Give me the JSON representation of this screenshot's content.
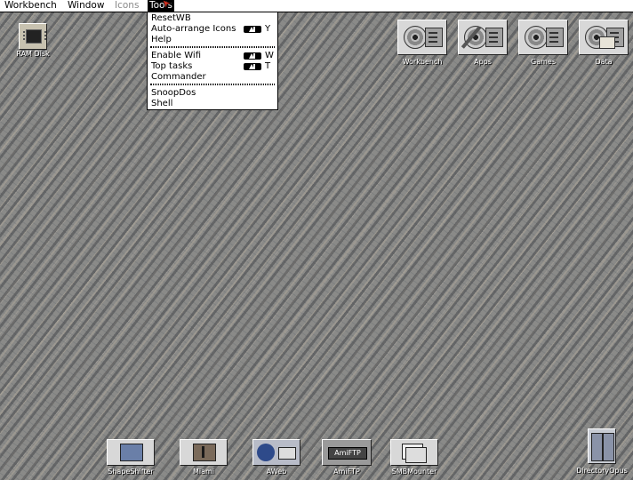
{
  "menubar": {
    "items": [
      {
        "label": "Workbench",
        "state": "normal"
      },
      {
        "label": "Window",
        "state": "normal"
      },
      {
        "label": "Icons",
        "state": "disabled"
      },
      {
        "label": "Tools",
        "state": "active"
      }
    ]
  },
  "tools_menu": {
    "groups": [
      [
        {
          "label": "ResetWB",
          "shortcut": ""
        },
        {
          "label": "Auto-arrange Icons",
          "shortcut": "Y"
        },
        {
          "label": "Help",
          "shortcut": ""
        }
      ],
      [
        {
          "label": "Enable Wifi",
          "shortcut": "W"
        },
        {
          "label": "Top tasks",
          "shortcut": "T"
        },
        {
          "label": "Commander",
          "shortcut": ""
        }
      ],
      [
        {
          "label": "SnoopDos",
          "shortcut": ""
        },
        {
          "label": "Shell",
          "shortcut": ""
        }
      ]
    ]
  },
  "desktop": {
    "top_left_icons": [
      {
        "label": "RAM Disk",
        "icon": "ram-disk-icon"
      }
    ],
    "drive_icons": [
      {
        "label": "Workbench",
        "icon": "harddisk-icon"
      },
      {
        "label": "Apps",
        "icon": "harddisk-tools-icon"
      },
      {
        "label": "Games",
        "icon": "harddisk-icon"
      },
      {
        "label": "Data",
        "icon": "harddisk-folder-icon"
      }
    ],
    "bottom_icons": [
      {
        "label": "ShapeShifter",
        "icon": "shapeshifter-icon"
      },
      {
        "label": "Miami",
        "icon": "miami-icon"
      },
      {
        "label": "AWeb",
        "icon": "aweb-icon"
      },
      {
        "label": "AmiFTP",
        "icon": "amiftp-icon",
        "badge": "AmiFTP"
      },
      {
        "label": "SMBMounter",
        "icon": "smbmounter-icon"
      }
    ],
    "bottom_right_icon": {
      "label": "DirectoryOpus",
      "icon": "directoryopus-icon"
    }
  }
}
